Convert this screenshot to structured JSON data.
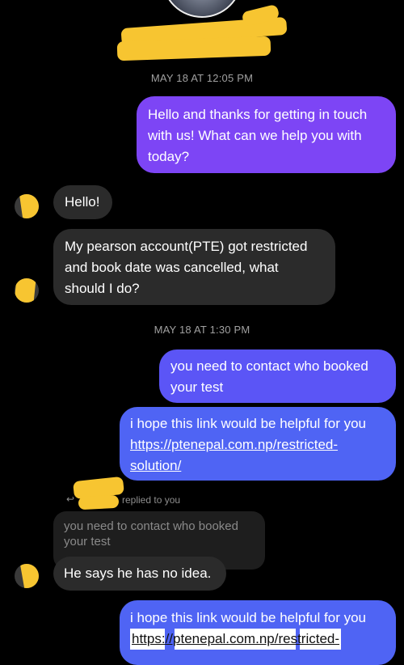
{
  "chat": {
    "timestamps": [
      "MAY 18 AT 12:05 PM",
      "MAY 18 AT 1:30 PM"
    ],
    "messages": {
      "m1": {
        "lines": [
          "Hello and thanks for getting in touch",
          "with us! What can we help you with",
          "today?"
        ]
      },
      "m2": {
        "text": "Hello!"
      },
      "m3": {
        "lines": [
          "My pearson account(PTE) got restricted",
          "and book date was cancelled, what",
          "should I do?"
        ]
      },
      "m4": {
        "lines": [
          "you need to contact who booked",
          "your test"
        ]
      },
      "m5": {
        "lines": [
          "i hope this link would be helpful for you"
        ],
        "link_lines": [
          "https://ptenepal.com.np/restricted-",
          "solution/"
        ]
      },
      "m6": {
        "text": "He says he has no idea."
      },
      "m7": {
        "lines": [
          "i hope this link would be helpful for you"
        ],
        "link_lines": [
          "https://ptenepal.com.np/restricted-"
        ]
      }
    },
    "reply": {
      "label": "replied to you",
      "quoted_lines": [
        "you need to contact who booked",
        "your test"
      ]
    }
  },
  "colors": {
    "background": "#000000",
    "outgoing_purple": "#7d45f5",
    "outgoing_indigo": "#5b55f6",
    "outgoing_blue": "#4f64f4",
    "incoming_gray": "#2b2b2b",
    "redaction_yellow": "#f7c531"
  }
}
